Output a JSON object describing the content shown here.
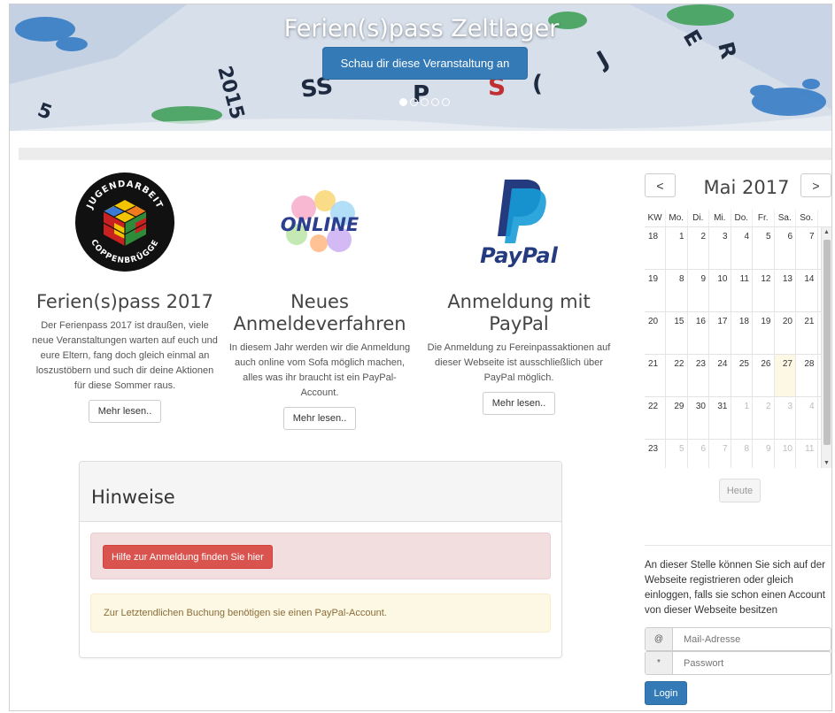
{
  "hero": {
    "title": "Ferien(s)pass Zeltlager",
    "button_label": "Schau dir diese Veranstaltung an",
    "slide_count": 5,
    "active_slide": 1
  },
  "features": [
    {
      "title": "Ferien(s)pass 2017",
      "text": "Der Ferienpass 2017 ist draußen, viele neue Veranstaltungen warten auf euch und eure Eltern, fang doch gleich einmal an loszustöbern und such dir deine Aktionen für diese Sommer raus.",
      "button": "Mehr lesen..",
      "logo_top": "JUGENDARBEIT",
      "logo_bottom": "COPPENBRÜGGE"
    },
    {
      "title": "Neues Anmeldeverfahren",
      "text": "In diesem Jahr werden wir die Anmeldung auch online vom Sofa möglich machen, alles was ihr braucht ist ein PayPal-Account.",
      "button": "Mehr lesen..",
      "logo_text": "ONLINE"
    },
    {
      "title": "Anmeldung mit PayPal",
      "text": "Die Anmeldung zu Fereinpassaktionen auf dieser Webseite ist ausschließlich über PayPal möglich.",
      "button": "Mehr lesen..",
      "logo_text": "PayPal"
    }
  ],
  "hinweise": {
    "title": "Hinweise",
    "danger_button": "Hilfe zur Anmeldung finden Sie hier",
    "warning_text": "Zur Letztendlichen Buchung benötigen sie einen PayPal-Account."
  },
  "calendar": {
    "prev": "<",
    "next": ">",
    "title": "Mai 2017",
    "headers": [
      "KW",
      "Mo.",
      "Di.",
      "Mi.",
      "Do.",
      "Fr.",
      "Sa.",
      "So."
    ],
    "weeks": [
      {
        "kw": "18",
        "days": [
          "1",
          "2",
          "3",
          "4",
          "5",
          "6",
          "7"
        ],
        "muted": [],
        "today": -1
      },
      {
        "kw": "19",
        "days": [
          "8",
          "9",
          "10",
          "11",
          "12",
          "13",
          "14"
        ],
        "muted": [],
        "today": -1
      },
      {
        "kw": "20",
        "days": [
          "15",
          "16",
          "17",
          "18",
          "19",
          "20",
          "21"
        ],
        "muted": [],
        "today": -1
      },
      {
        "kw": "21",
        "days": [
          "22",
          "23",
          "24",
          "25",
          "26",
          "27",
          "28"
        ],
        "muted": [],
        "today": 5
      },
      {
        "kw": "22",
        "days": [
          "29",
          "30",
          "31",
          "1",
          "2",
          "3",
          "4"
        ],
        "muted": [
          3,
          4,
          5,
          6
        ],
        "today": -1
      },
      {
        "kw": "23",
        "days": [
          "5",
          "6",
          "7",
          "8",
          "9",
          "10",
          "11"
        ],
        "muted": [
          0,
          1,
          2,
          3,
          4,
          5,
          6
        ],
        "today": -1
      }
    ],
    "today_button": "Heute"
  },
  "login": {
    "intro": "An dieser Stelle können Sie sich auf der Webseite registrieren oder gleich einloggen, falls sie schon einen Account von dieser Webseite besitzen",
    "email_addon": "@",
    "email_placeholder": "Mail-Adresse",
    "password_addon": "*",
    "password_placeholder": "Passwort",
    "button": "Login"
  },
  "colors": {
    "primary": "#337ab7",
    "danger": "#d9534f",
    "warning_bg": "#fcf8e3",
    "danger_bg": "#f2dede",
    "today_bg": "#fcf8e3"
  }
}
